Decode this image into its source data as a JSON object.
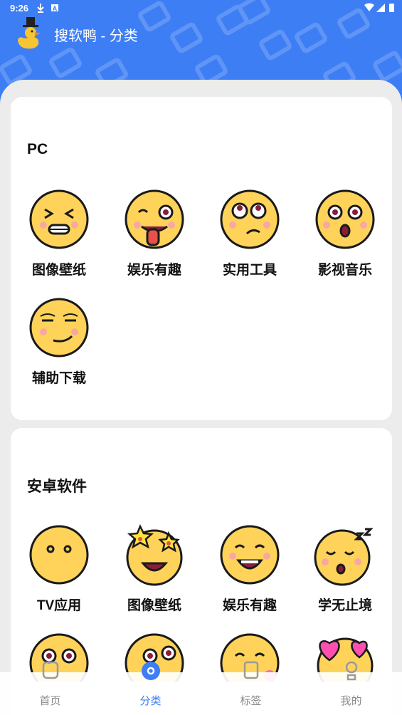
{
  "status_bar": {
    "time": "9:26"
  },
  "app": {
    "title": "搜软鸭 - 分类"
  },
  "colors": {
    "primary": "#3d7ef5",
    "face": "#ffd35a",
    "outline": "#1a1a1a"
  },
  "sections": [
    {
      "title": "PC",
      "items": [
        {
          "label": "图像壁纸",
          "icon": "squinting-face-icon"
        },
        {
          "label": "娱乐有趣",
          "icon": "tongue-wink-face-icon"
        },
        {
          "label": "实用工具",
          "icon": "eye-roll-face-icon"
        },
        {
          "label": "影视音乐",
          "icon": "surprised-face-icon"
        },
        {
          "label": "辅助下载",
          "icon": "smirk-face-icon"
        }
      ]
    },
    {
      "title": "安卓软件",
      "items": [
        {
          "label": "TV应用",
          "icon": "blank-face-icon"
        },
        {
          "label": "图像壁纸",
          "icon": "star-eyes-face-icon"
        },
        {
          "label": "娱乐有趣",
          "icon": "grinning-face-icon"
        },
        {
          "label": "学无止境",
          "icon": "sleeping-face-icon"
        }
      ]
    }
  ],
  "bottom_nav": [
    {
      "label": "首页",
      "icon": "home-icon",
      "active": false
    },
    {
      "label": "分类",
      "icon": "category-icon",
      "active": true
    },
    {
      "label": "标签",
      "icon": "tag-icon",
      "active": false
    },
    {
      "label": "我的",
      "icon": "profile-icon",
      "active": false
    }
  ]
}
